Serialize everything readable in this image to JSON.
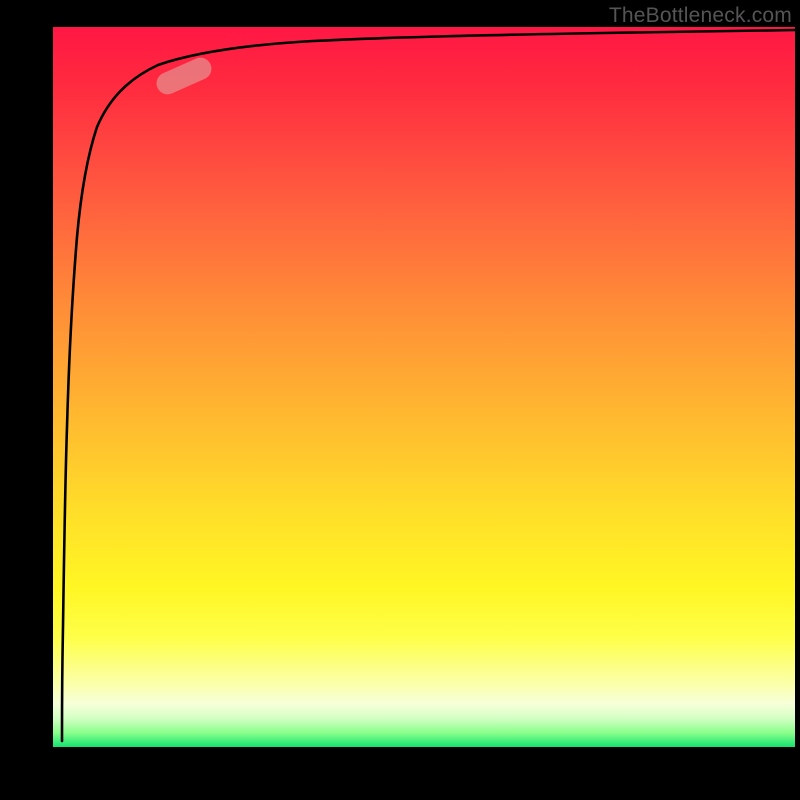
{
  "attribution": "TheBottleneck.com",
  "chart_data": {
    "type": "line",
    "title": "",
    "xlabel": "",
    "ylabel": "",
    "xlim": [
      0,
      100
    ],
    "ylim": [
      0,
      100
    ],
    "grid": false,
    "legend": false,
    "background_gradient": {
      "direction": "vertical",
      "stops": [
        {
          "pos": 0,
          "color": "#ff1744",
          "meaning": "high-bottleneck"
        },
        {
          "pos": 50,
          "color": "#ffc107",
          "meaning": "mid-bottleneck"
        },
        {
          "pos": 100,
          "color": "#14e36e",
          "meaning": "no-bottleneck"
        }
      ]
    },
    "series": [
      {
        "name": "bottleneck-curve",
        "x": [
          1,
          1.5,
          2,
          2.5,
          3,
          4,
          5,
          7,
          10,
          15,
          20,
          30,
          50,
          70,
          100
        ],
        "y": [
          1,
          30,
          55,
          70,
          78,
          84,
          87,
          90,
          92,
          93.5,
          94.5,
          95.5,
          96.5,
          97,
          97.5
        ]
      }
    ],
    "marker": {
      "series": "bottleneck-curve",
      "approx_x": 15,
      "approx_y": 93.5,
      "shape": "pill",
      "color": "#e68c8c"
    }
  }
}
